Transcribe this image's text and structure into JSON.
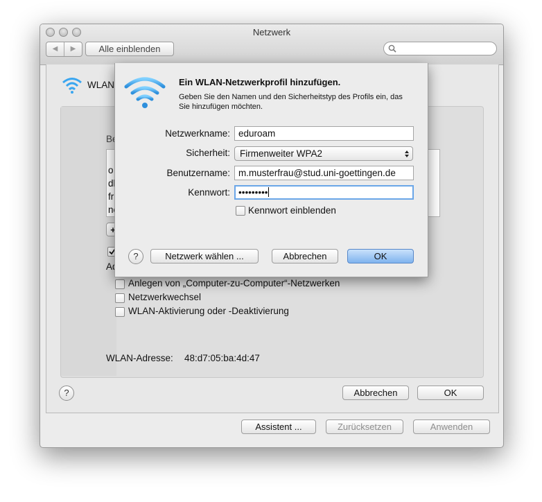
{
  "window": {
    "title": "Netzwerk",
    "show_all": "Alle einblenden",
    "search_placeholder": "",
    "nav_back": "◀",
    "nav_forward": "▶"
  },
  "background": {
    "service_name": "WLAN",
    "checkboxes": [
      "Anlegen von „Computer-zu-Computer“-Netzwerken",
      "Netzwerkwechsel",
      "WLAN-Aktivierung oder -Deaktivierung"
    ],
    "address_label": "WLAN-Adresse:",
    "address_value": "48:d7:05:ba:4d:47",
    "cancel": "Abbrechen",
    "ok": "OK",
    "faded": {
      "list_prefix": [
        "o",
        "dl",
        "fr",
        "ne"
      ],
      "be": "Be",
      "ad": "Ad",
      "plus": "+"
    }
  },
  "footer": {
    "assistant": "Assistent ...",
    "reset": "Zurücksetzen",
    "apply": "Anwenden"
  },
  "sheet": {
    "title": "Ein WLAN-Netzwerkprofil hinzufügen.",
    "subtitle": "Geben Sie den Namen und den Sicherheitstyp des Profils ein, das Sie hinzufügen möchten.",
    "network_name_label": "Netzwerkname:",
    "network_name_value": "eduroam",
    "security_label": "Sicherheit:",
    "security_value": "Firmenweiter WPA2",
    "username_label": "Benutzername:",
    "username_value": "m.musterfrau@stud.uni-goettingen.de",
    "password_label": "Kennwort:",
    "password_value": "•••••••••",
    "show_password": "Kennwort einblenden",
    "help": "?",
    "choose_network": "Netzwerk wählen ...",
    "cancel": "Abbrechen",
    "ok": "OK"
  },
  "colors": {
    "wifi": "#3aa6f0",
    "ok_blue": "#8ec0f3",
    "focus": "#6aa6e8"
  }
}
